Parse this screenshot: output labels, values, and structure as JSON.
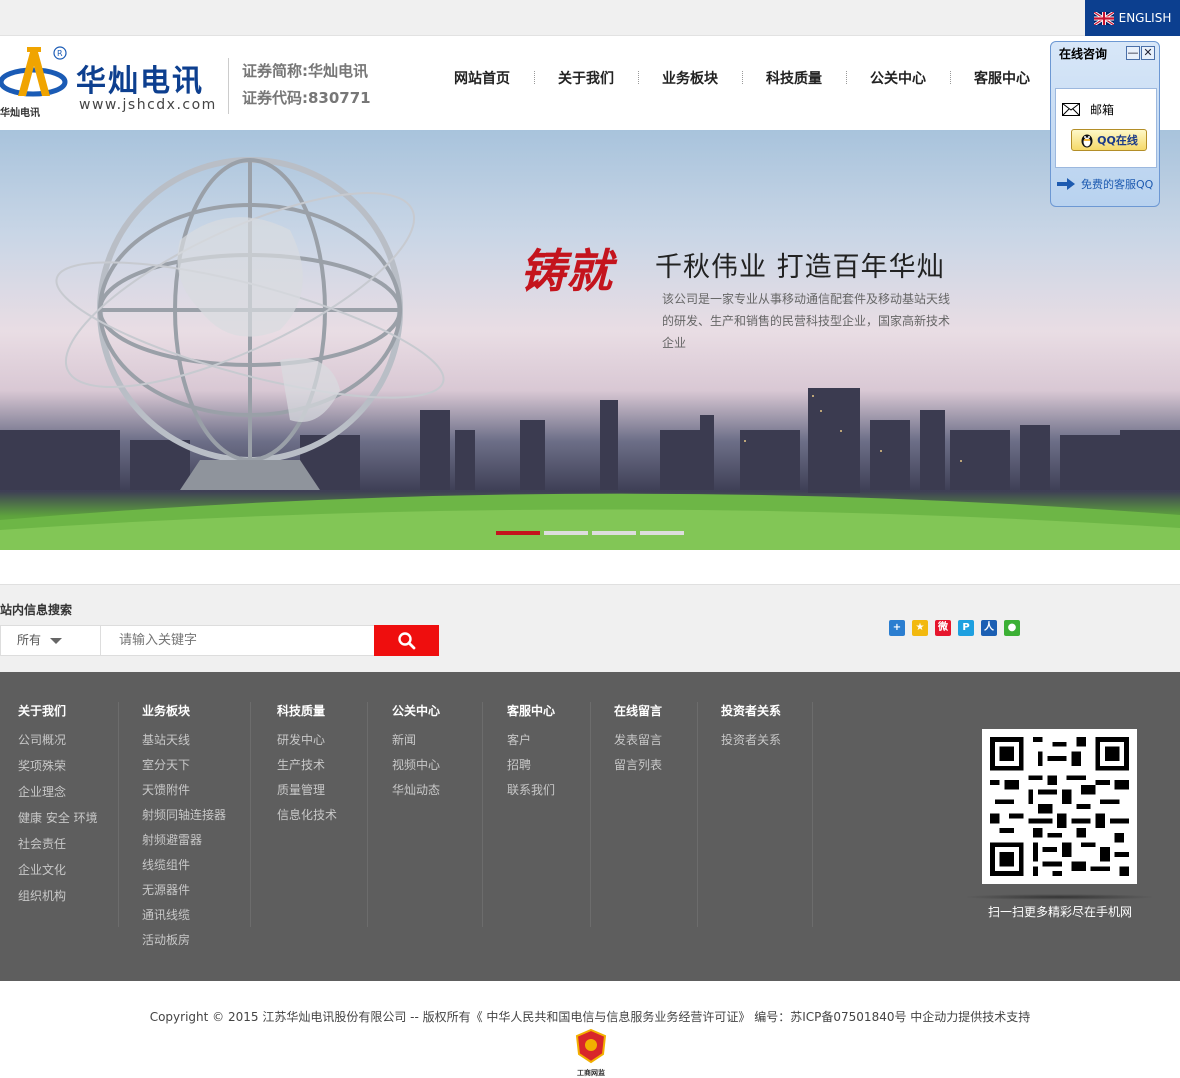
{
  "topbar": {
    "english_label": "ENGLISH"
  },
  "header": {
    "logo_name": "华灿电讯",
    "logo_url": "www.jshcdx.com",
    "logo_cn_small": "华灿电讯",
    "stock_short": "证券简称:华灿电讯",
    "stock_code": "证券代码:830771"
  },
  "nav": {
    "items": [
      "网站首页",
      "关于我们",
      "业务板块",
      "科技质量",
      "公关中心",
      "客服中心"
    ]
  },
  "chat": {
    "title": "在线咨询",
    "mail_label": "邮箱",
    "qq_label": "QQ在线",
    "free_label": "免费的客服QQ",
    "min_glyph": "—",
    "close_glyph": "✕"
  },
  "banner": {
    "calligraphy": "铸就",
    "title": "千秋伟业 打造百年华灿",
    "description": "该公司是一家专业从事移动通信配套件及移动基站天线的研发、生产和销售的民营科技型企业，国家高新技术企业",
    "slides_count": 4,
    "active_slide": 0
  },
  "search": {
    "label": "站内信息搜索",
    "select_value": "所有",
    "placeholder": "请输入关键字"
  },
  "footer": {
    "columns": [
      {
        "head": "关于我们",
        "items": [
          "公司概况",
          "奖项殊荣",
          "企业理念",
          "健康 安全 环境",
          "社会责任",
          "企业文化",
          "组织机构"
        ]
      },
      {
        "head": "业务板块",
        "items": [
          "基站天线",
          "室分天下",
          "天馈附件",
          "射频同轴连接器",
          "射频避雷器",
          "线缆组件",
          "无源器件",
          "通讯线缆",
          "活动板房"
        ]
      },
      {
        "head": "科技质量",
        "items": [
          "研发中心",
          "生产技术",
          "质量管理",
          "信息化技术"
        ]
      },
      {
        "head": "公关中心",
        "items": [
          "新闻",
          "视频中心",
          "华灿动态"
        ]
      },
      {
        "head": "客服中心",
        "items": [
          "客户",
          "招聘",
          "联系我们"
        ]
      },
      {
        "head": "在线留言",
        "items": [
          "发表留言",
          "留言列表"
        ]
      },
      {
        "head": "投资者关系",
        "items": [
          "投资者关系"
        ]
      }
    ],
    "qr_caption": "扫一扫更多精彩尽在手机网"
  },
  "copyright": "Copyright © 2015  江苏华灿电讯股份有限公司  -- 版权所有《 中华人民共和国电信与信息服务业务经营许可证》 编号：苏ICP备07501840号  中企动力提供技术支持",
  "badge_text": "工商网监",
  "colors": {
    "brand_blue": "#0d3f8f",
    "accent_red": "#ef0e0e",
    "footer_gray": "#5e5e5e"
  }
}
